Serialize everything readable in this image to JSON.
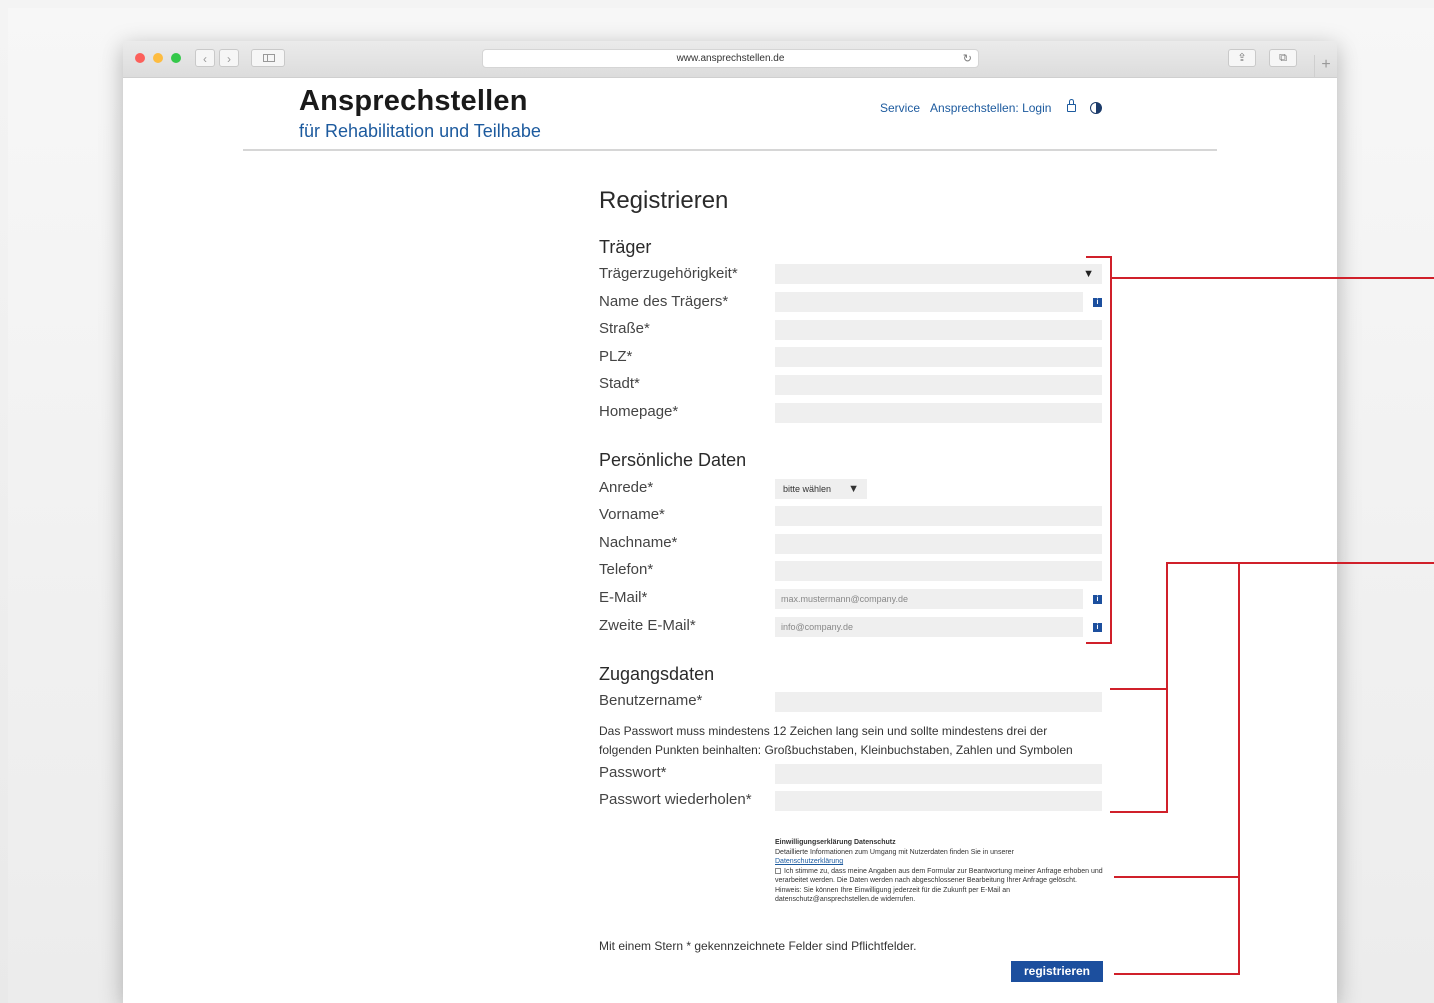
{
  "browser": {
    "url": "www.ansprechstellen.de",
    "nav_back": "‹",
    "nav_forward": "›",
    "reload": "↻",
    "share": "⇪",
    "tabs": "⧉",
    "new_tab": "+"
  },
  "header": {
    "logo_title": "Ansprechstellen",
    "logo_subtitle": "für Rehabilitation und Teilhabe",
    "nav_service": "Service",
    "nav_login": "Ansprechstellen: Login"
  },
  "form": {
    "title": "Registrieren",
    "section_traeger": "Träger",
    "traeger_zugehoerigkeit": "Trägerzugehörigkeit*",
    "traeger_name": "Name des Trägers*",
    "strasse": "Straße*",
    "plz": "PLZ*",
    "stadt": "Stadt*",
    "homepage": "Homepage*",
    "section_personal": "Persönliche Daten",
    "anrede": "Anrede*",
    "anrede_value": "bitte wählen",
    "vorname": "Vorname*",
    "nachname": "Nachname*",
    "telefon": "Telefon*",
    "email": "E-Mail*",
    "email_placeholder": "max.mustermann@company.de",
    "email2": "Zweite E-Mail*",
    "email2_placeholder": "info@company.de",
    "section_access": "Zugangsdaten",
    "username": "Benutzername*",
    "password_hint": "Das Passwort muss mindestens 12 Zeichen lang sein und sollte mindestens drei der folgenden Punkten beinhalten: Großbuchstaben, Kleinbuchstaben, Zahlen und Symbolen",
    "password": "Passwort*",
    "password_repeat": "Passwort wiederholen*",
    "consent_title": "Einwilligungserklärung Datenschutz",
    "consent_intro": "Detaillierte Informationen zum Umgang mit Nutzerdaten finden Sie in unserer",
    "consent_link": "Datenschutzerklärung",
    "consent_text": "Ich stimme zu, dass meine Angaben aus dem Formular zur Beantwortung meiner Anfrage erhoben und verarbeitet werden. Die Daten werden nach abgeschlossener Bearbeitung Ihrer Anfrage gelöscht. Hinweis: Sie können Ihre Einwilligung jederzeit für die Zukunft per E-Mail an datenschutz@ansprechstellen.de widerrufen.",
    "required_note": "Mit einem Stern * gekennzeichnete Felder sind Pflichtfelder.",
    "submit_label": "registrieren",
    "info_glyph": "i",
    "dropdown_arrow": "▼"
  },
  "colors": {
    "brand_blue": "#1c5a9e",
    "button_blue": "#1c4f9e",
    "annotation_red": "#d0202a"
  }
}
